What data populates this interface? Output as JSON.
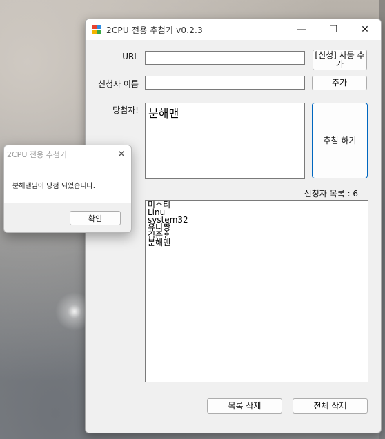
{
  "window": {
    "title": "2CPU 전용 추첨기 v0.2.3",
    "icon": "app-icon",
    "controls": {
      "minimize": "—",
      "maximize": "☐",
      "close": "✕"
    }
  },
  "form": {
    "url_label": "URL",
    "url_value": "",
    "auto_add_button": "[신청] 자동 추가",
    "applicant_label": "신청자 이름",
    "applicant_value": "",
    "add_button": "추가",
    "winner_label": "당첨자!",
    "winner_value": "분해맨",
    "draw_button": "추첨 하기",
    "applicant_count": "신청자 목록 : 6"
  },
  "applicants": [
    "미스티",
    "Linu",
    "system32",
    "유니짱",
    "김준휴",
    "분해맨"
  ],
  "footer": {
    "delete_list_button": "목록 삭제",
    "delete_all_button": "전체 삭제"
  },
  "dialog": {
    "title": "2CPU 전용 추첨기",
    "close": "✕",
    "message": "분해맨님이 당첨 되었습니다.",
    "ok_button": "확인"
  },
  "colors": {
    "accent": "#0067c0",
    "window_bg": "#f0f0f0",
    "titlebar_bg": "#ffffff"
  }
}
